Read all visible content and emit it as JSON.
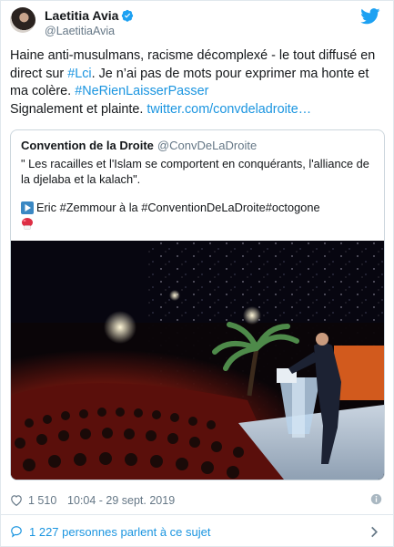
{
  "colors": {
    "link": "#1b95e0",
    "secondary_text": "#657786",
    "border": "#e1e8ed"
  },
  "author": {
    "display_name": "Laetitia Avia",
    "handle": "@LaetitiaAvia",
    "verified": true,
    "avatar_icon": "avatar"
  },
  "tweet": {
    "line1": "Haine anti-musulmans, racisme décomplexé - le tout diffusé en",
    "line2_pre": "direct sur ",
    "line2_link": "#Lci",
    "line2_post": ". Je n’ai pas de mots pour exprimer ma honte et",
    "line3_pre": "ma colère. ",
    "line3_link": "#NeRienLaisserPasser",
    "line4_pre": "Signalement et plainte. ",
    "line4_link": "twitter.com/convdeladroite…"
  },
  "quoted": {
    "name": "Convention de la Droite",
    "handle": "@ConvDeLaDroite",
    "text": "\" Les racailles et l'Islam se comportent en conquérants, l'alliance de la djelaba et la kalach\".",
    "line2": "Eric #Zemmour à la #ConventionDeLaDroite#octogone",
    "play_icon": "play-icon",
    "extra_icon": "boxing-glove-icon"
  },
  "footer": {
    "likes": "1 510",
    "timestamp": "10:04 - 29 sept. 2019",
    "conversation": "1 227 personnes parlent à ce sujet"
  }
}
